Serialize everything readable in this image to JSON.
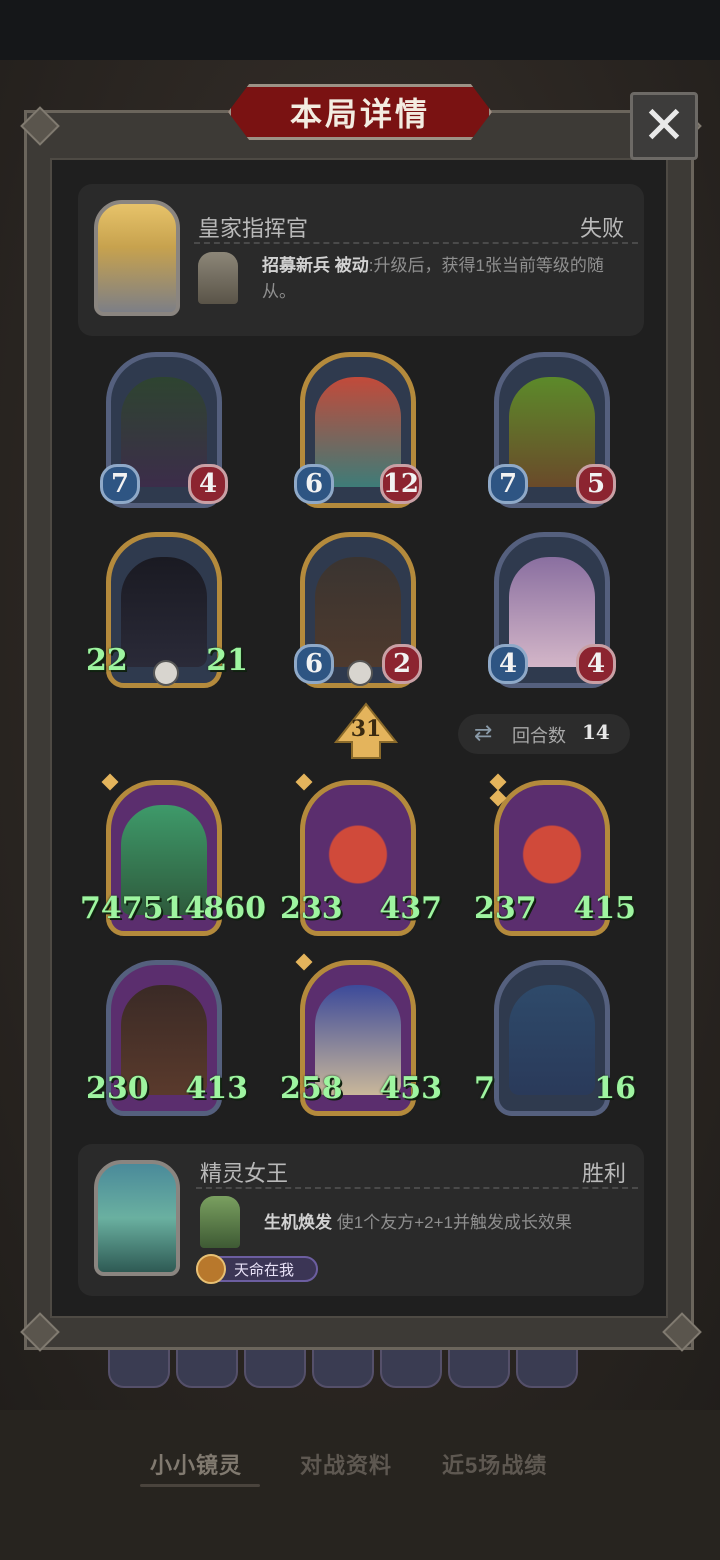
{
  "header": {
    "title": "本局详情"
  },
  "close": {
    "icon": "close-icon",
    "symbol": "✕"
  },
  "opponent": {
    "name": "皇家指挥官",
    "result": "失败",
    "skill_name": "招募新兵",
    "skill_type": "被动",
    "skill_desc": ":升级后，获得1张当前等级的随从。"
  },
  "level": "31",
  "round": {
    "label": "回合数",
    "value": "14"
  },
  "opponent_units": [
    {
      "atk": "7",
      "hp": "4"
    },
    {
      "atk": "6",
      "hp": "12"
    },
    {
      "atk": "7",
      "hp": "5"
    },
    {
      "atk": "22",
      "hp": "21"
    },
    {
      "atk": "6",
      "hp": "2"
    },
    {
      "atk": "4",
      "hp": "4"
    }
  ],
  "player_units": [
    {
      "atk": "747514",
      "hp": "860"
    },
    {
      "atk": "233",
      "hp": "437"
    },
    {
      "atk": "237",
      "hp": "415"
    },
    {
      "atk": "230",
      "hp": "413"
    },
    {
      "atk": "258",
      "hp": "453"
    },
    {
      "atk": "7",
      "hp": "16"
    }
  ],
  "player": {
    "name": "精灵女王",
    "result": "胜利",
    "skill_name": "生机焕发",
    "skill_desc": "使1个友方+2+1并触发成长效果",
    "badge": "天命在我"
  },
  "tabs": [
    "小小镜灵",
    "对战资料",
    "近5场战绩"
  ],
  "colors": {
    "title_plaque": "#7a1212",
    "big_stat": "#9ef5a0",
    "atk": "#2e5583",
    "hp": "#8c2430",
    "gold_frame": "#b48a3c",
    "silver_frame": "#55607e"
  }
}
